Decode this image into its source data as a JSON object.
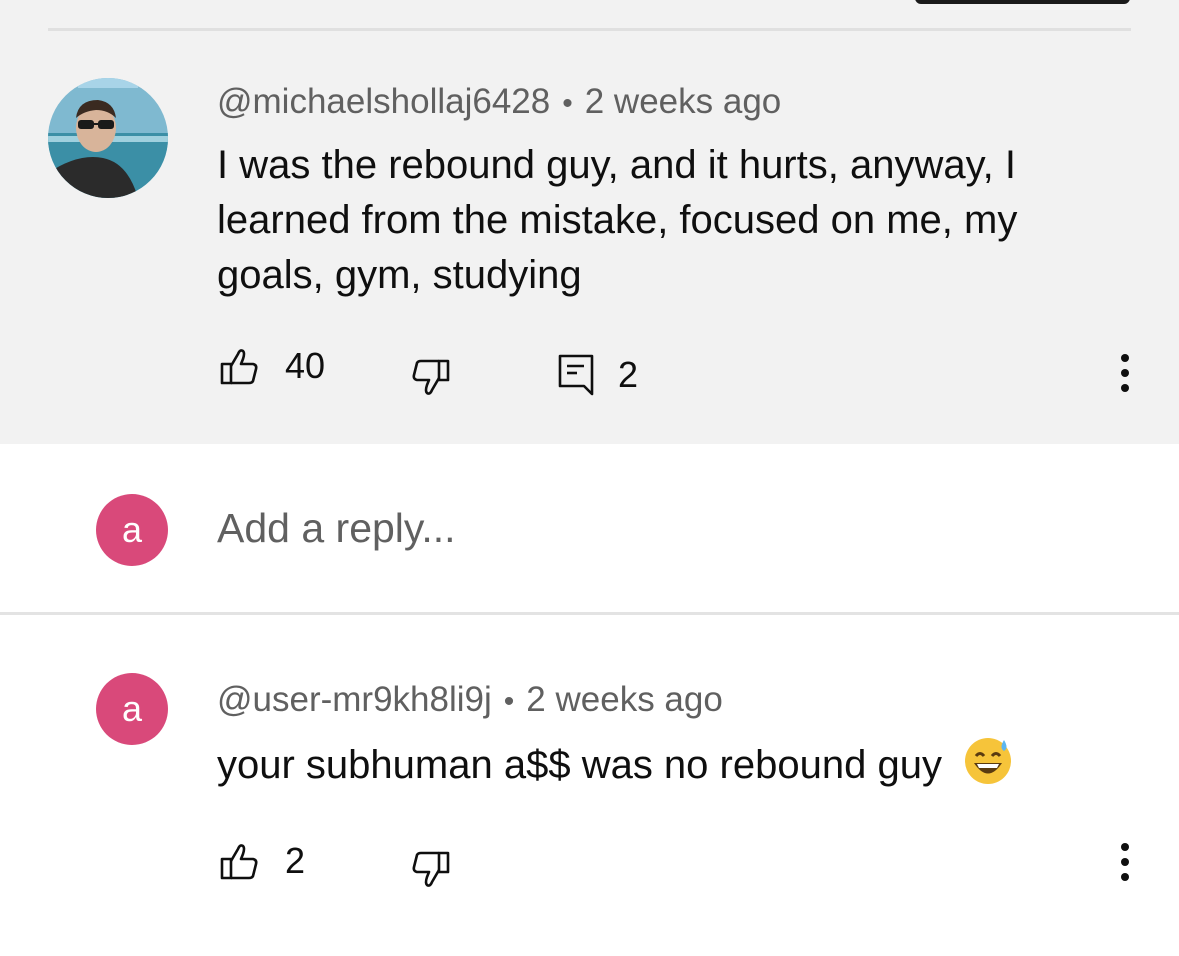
{
  "comment": {
    "handle": "@michaelshollaj6428",
    "time": "2 weeks ago",
    "text": "I was the rebound guy, and it hurts, anyway, I learned from the mistake, focused on me, my goals, gym, studying",
    "likes": "40",
    "replies": "2",
    "separator": "•"
  },
  "reply_box": {
    "avatar_letter": "a",
    "placeholder": "Add a reply..."
  },
  "reply": {
    "avatar_letter": "a",
    "handle": "@user-mr9kh8li9j",
    "time": "2 weeks ago",
    "text": "your subhuman a$$ was no rebound guy",
    "emoji": "😅",
    "likes": "2",
    "separator": "•"
  },
  "colors": {
    "avatar_pink": "#d9497a",
    "highlight_bg": "#f2f2f2",
    "secondary_text": "#606060"
  }
}
